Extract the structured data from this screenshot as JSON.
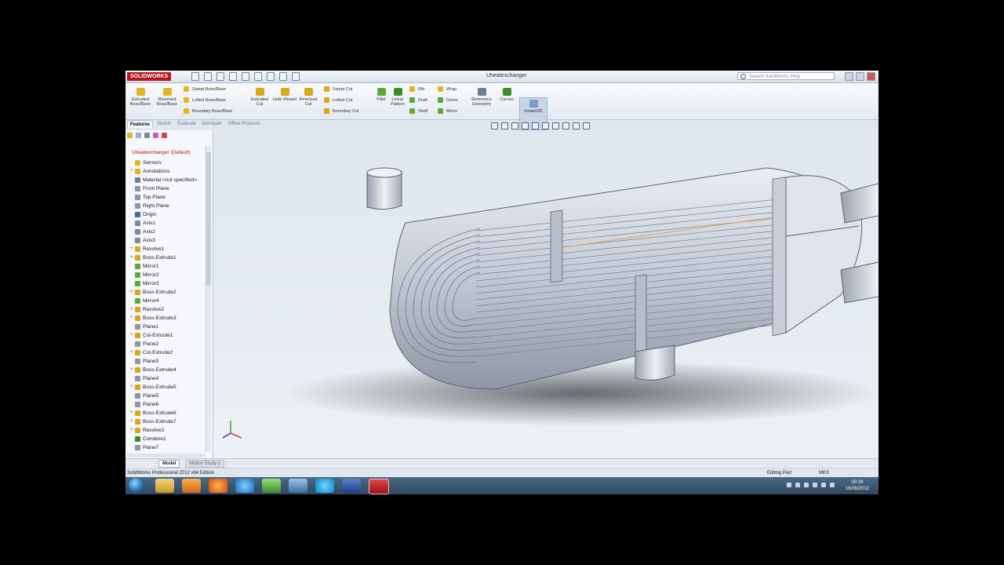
{
  "window": {
    "brand": "SOLIDWORKS",
    "title": "Uheatexchanger",
    "search_placeholder": "Search SolidWorks Help"
  },
  "ribbon": {
    "extruded_boss": "Extruded Boss/Base",
    "revolved_boss": "Revolved Boss/Base",
    "swept_boss": "Swept Boss/Base",
    "lofted_boss": "Lofted Boss/Base",
    "boundary_boss": "Boundary Boss/Base",
    "extruded_cut": "Extruded Cut",
    "hole_wizard": "Hole Wizard",
    "revolved_cut": "Revolved Cut",
    "swept_cut": "Swept Cut",
    "lofted_cut": "Lofted Cut",
    "boundary_cut": "Boundary Cut",
    "fillet": "Fillet",
    "linear_pattern": "Linear Pattern",
    "rib": "Rib",
    "draft": "Draft",
    "shell": "Shell",
    "wrap": "Wrap",
    "dome": "Dome",
    "mirror": "Mirror",
    "reference_geometry": "Reference Geometry",
    "curves": "Curves",
    "instant3d": "Instant3D"
  },
  "command_tabs": [
    "Features",
    "Sketch",
    "Evaluate",
    "DimXpert",
    "Office Products"
  ],
  "feature_tree": {
    "root": "Uheatexchanger (Default)",
    "items": [
      {
        "label": "Sensors",
        "icon": "folder-icon",
        "expandable": false
      },
      {
        "label": "Annotations",
        "icon": "annotation-icon",
        "expandable": true
      },
      {
        "label": "Material <not specified>",
        "icon": "material-icon",
        "expandable": false
      },
      {
        "label": "Front Plane",
        "icon": "plane-icon",
        "expandable": false
      },
      {
        "label": "Top Plane",
        "icon": "plane-icon",
        "expandable": false
      },
      {
        "label": "Right Plane",
        "icon": "plane-icon",
        "expandable": false
      },
      {
        "label": "Origin",
        "icon": "origin-icon",
        "expandable": false
      },
      {
        "label": "Axis1",
        "icon": "axis-icon",
        "expandable": false
      },
      {
        "label": "Axis2",
        "icon": "axis-icon",
        "expandable": false
      },
      {
        "label": "Axis3",
        "icon": "axis-icon",
        "expandable": false
      },
      {
        "label": "Revolve1",
        "icon": "feature-icon",
        "expandable": true
      },
      {
        "label": "Boss-Extrude1",
        "icon": "feature-icon",
        "expandable": true
      },
      {
        "label": "Mirror1",
        "icon": "mirror-icon",
        "expandable": false
      },
      {
        "label": "Mirror2",
        "icon": "mirror-icon",
        "expandable": false
      },
      {
        "label": "Mirror3",
        "icon": "mirror-icon",
        "expandable": false
      },
      {
        "label": "Boss-Extrude2",
        "icon": "feature-icon",
        "expandable": true
      },
      {
        "label": "Mirror4",
        "icon": "mirror-icon",
        "expandable": false
      },
      {
        "label": "Revolve2",
        "icon": "feature-icon",
        "expandable": true
      },
      {
        "label": "Boss-Extrude3",
        "icon": "feature-icon",
        "expandable": true
      },
      {
        "label": "Plane1",
        "icon": "plane-icon",
        "expandable": false
      },
      {
        "label": "Cut-Extrude1",
        "icon": "feature-icon",
        "expandable": true
      },
      {
        "label": "Plane2",
        "icon": "plane-icon",
        "expandable": false
      },
      {
        "label": "Cut-Extrude2",
        "icon": "feature-icon",
        "expandable": true
      },
      {
        "label": "Plane3",
        "icon": "plane-icon",
        "expandable": false
      },
      {
        "label": "Boss-Extrude4",
        "icon": "feature-icon",
        "expandable": true
      },
      {
        "label": "Plane4",
        "icon": "plane-icon",
        "expandable": false
      },
      {
        "label": "Boss-Extrude5",
        "icon": "feature-icon",
        "expandable": true
      },
      {
        "label": "Plane5",
        "icon": "plane-icon",
        "expandable": false
      },
      {
        "label": "Plane6",
        "icon": "plane-icon",
        "expandable": false
      },
      {
        "label": "Boss-Extrude6",
        "icon": "feature-icon",
        "expandable": true
      },
      {
        "label": "Boss-Extrude7",
        "icon": "feature-icon",
        "expandable": true
      },
      {
        "label": "Revolve3",
        "icon": "feature-icon",
        "expandable": true
      },
      {
        "label": "Combine1",
        "icon": "combine-icon",
        "expandable": false
      },
      {
        "label": "Plane7",
        "icon": "plane-icon",
        "expandable": false
      }
    ]
  },
  "bottom_tabs": {
    "model": "Model",
    "motion": "Motion Study 1"
  },
  "status": {
    "product": "SolidWorks Professional 2012 x64 Edition",
    "mode": "Editing Part",
    "units": "MKS"
  },
  "taskbar": {
    "apps": [
      "explorer-icon",
      "media-player-icon",
      "firefox-icon",
      "internet-explorer-icon",
      "network-icon",
      "desktop-icon",
      "skype-icon",
      "visual-studio-icon",
      "solidworks-icon"
    ],
    "time": "00:39",
    "date": "16/06/2012"
  },
  "colors": {
    "brand_red": "#b8171c",
    "viewport_bg": "#e2e8ef",
    "model_gray": "#c7ccd6",
    "taskbar": "#3a566f"
  }
}
